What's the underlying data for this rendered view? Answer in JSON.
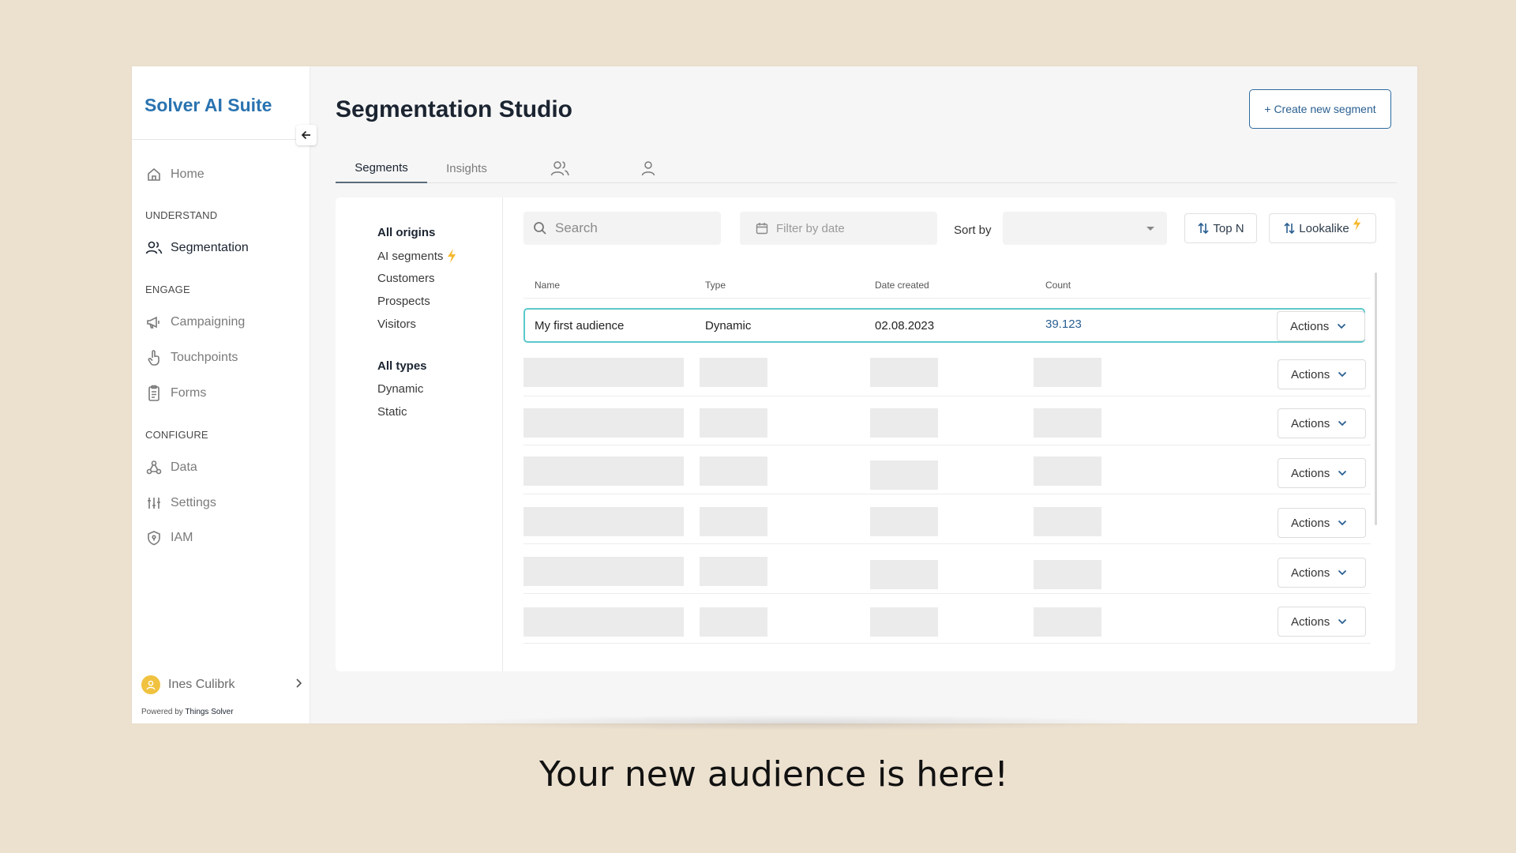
{
  "sidebar": {
    "brand": "Solver AI Suite",
    "items": [
      {
        "label": "Home",
        "icon": "home-icon"
      },
      {
        "label": "Segmentation",
        "icon": "users-icon",
        "active": true
      },
      {
        "label": "Campaigning",
        "icon": "megaphone-icon"
      },
      {
        "label": "Touchpoints",
        "icon": "touch-icon"
      },
      {
        "label": "Forms",
        "icon": "clipboard-icon"
      },
      {
        "label": "Data",
        "icon": "nodes-icon"
      },
      {
        "label": "Settings",
        "icon": "sliders-icon"
      },
      {
        "label": "IAM",
        "icon": "shield-icon"
      }
    ],
    "sections": [
      "UNDERSTAND",
      "ENGAGE",
      "CONFIGURE"
    ],
    "user": "Ines Culibrk",
    "powered_prefix": "Powered by",
    "powered_brand": "Things Solver"
  },
  "header": {
    "title": "Segmentation Studio",
    "create_button": "+ Create new segment"
  },
  "tabs": [
    {
      "label": "Segments",
      "active": true
    },
    {
      "label": "Insights"
    }
  ],
  "filters": {
    "origins": [
      "All origins",
      "AI segments",
      "Customers",
      "Prospects",
      "Visitors"
    ],
    "types": [
      "All types",
      "Dynamic",
      "Static"
    ]
  },
  "toolbar": {
    "search_placeholder": "Search",
    "date_placeholder": "Filter by date",
    "sort_label": "Sort by",
    "top_n": "Top N",
    "lookalike": "Lookalike"
  },
  "table": {
    "columns": [
      "Name",
      "Type",
      "Date created",
      "Count"
    ],
    "rows": [
      {
        "name": "My first audience",
        "type": "Dynamic",
        "date": "02.08.2023",
        "count": "39.123"
      }
    ],
    "actions_label": "Actions"
  },
  "colors": {
    "brand": "#2a73b0",
    "highlight": "#5cc8cc",
    "background": "#ece0cf",
    "accent_bolt": "#f5b82e"
  },
  "caption": "Your new audience is here!"
}
